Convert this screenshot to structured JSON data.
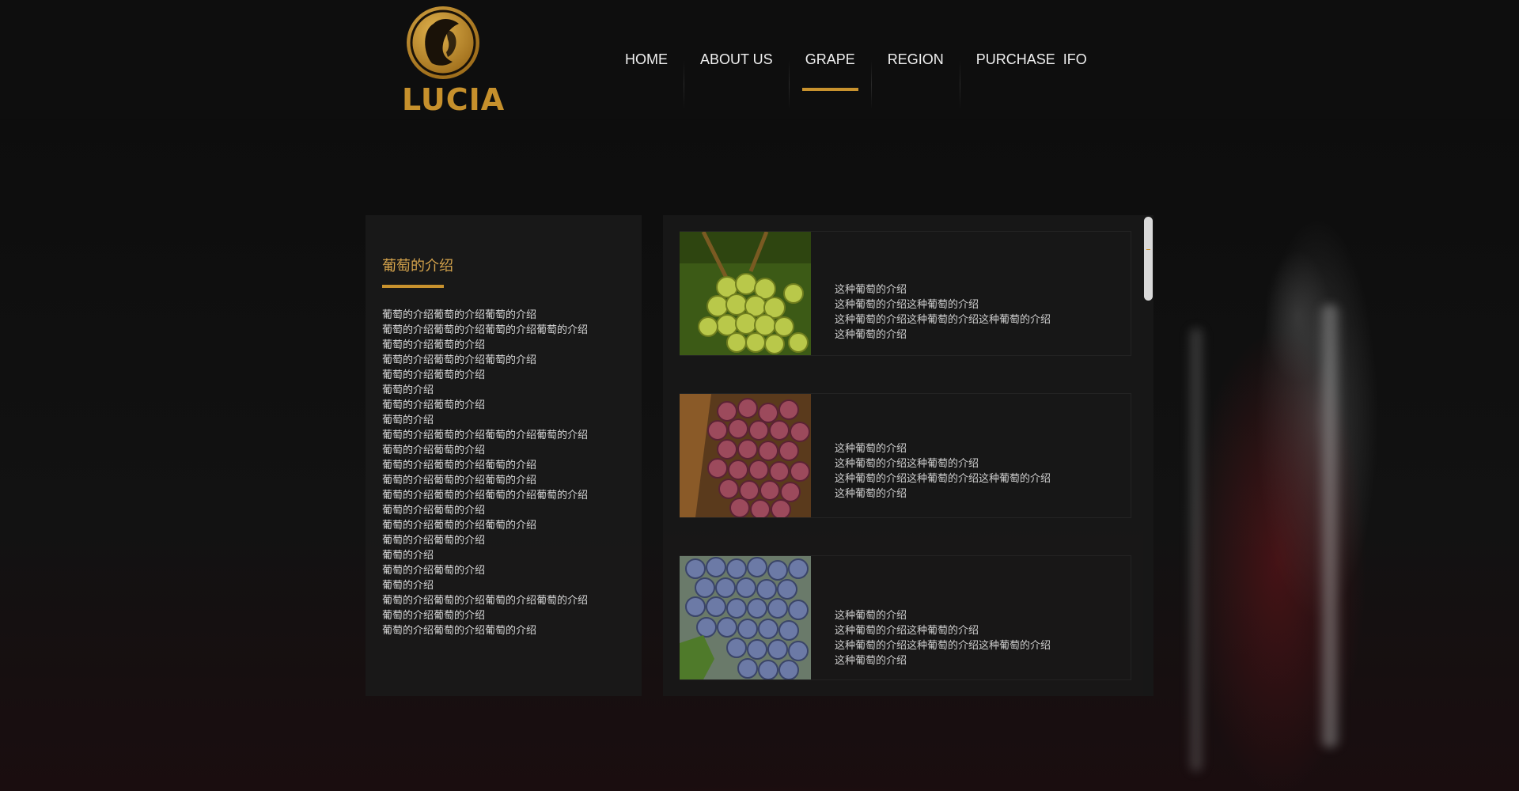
{
  "brand": {
    "logo_text": "LUCIA",
    "accent_color": "#c8922e"
  },
  "nav": {
    "items": [
      {
        "label": "HOME"
      },
      {
        "label": "ABOUT US"
      },
      {
        "label": "GRAPE",
        "active": true
      },
      {
        "label": "REGION"
      },
      {
        "label": "PURCHASE  IFO"
      }
    ]
  },
  "intro": {
    "title": "葡萄的介绍",
    "lines": [
      "葡萄的介绍葡萄的介绍葡萄的介绍",
      "葡萄的介绍葡萄的介绍葡萄的介绍葡萄的介绍",
      "葡萄的介绍葡萄的介绍",
      "葡萄的介绍葡萄的介绍葡萄的介绍",
      "葡萄的介绍葡萄的介绍",
      "葡萄的介绍",
      "葡萄的介绍葡萄的介绍",
      "葡萄的介绍",
      "葡萄的介绍葡萄的介绍葡萄的介绍葡萄的介绍",
      "葡萄的介绍葡萄的介绍",
      "葡萄的介绍葡萄的介绍葡萄的介绍",
      "葡萄的介绍葡萄的介绍葡萄的介绍",
      "葡萄的介绍葡萄的介绍葡萄的介绍葡萄的介绍",
      "葡萄的介绍葡萄的介绍",
      "葡萄的介绍葡萄的介绍葡萄的介绍",
      "葡萄的介绍葡萄的介绍",
      "葡萄的介绍",
      "葡萄的介绍葡萄的介绍",
      "葡萄的介绍",
      "葡萄的介绍葡萄的介绍葡萄的介绍葡萄的介绍",
      "葡萄的介绍葡萄的介绍",
      "葡萄的介绍葡萄的介绍葡萄的介绍"
    ]
  },
  "grapes": [
    {
      "image": "green-grapes",
      "lines": [
        "这种葡萄的介绍",
        "这种葡萄的介绍这种葡萄的介绍",
        "这种葡萄的介绍这种葡萄的介绍这种葡萄的介绍",
        "这种葡萄的介绍"
      ]
    },
    {
      "image": "red-grapes",
      "lines": [
        "这种葡萄的介绍",
        "这种葡萄的介绍这种葡萄的介绍",
        "这种葡萄的介绍这种葡萄的介绍这种葡萄的介绍",
        "这种葡萄的介绍"
      ]
    },
    {
      "image": "blue-grapes",
      "lines": [
        "这种葡萄的介绍",
        "这种葡萄的介绍这种葡萄的介绍",
        "这种葡萄的介绍这种葡萄的介绍这种葡萄的介绍",
        "这种葡萄的介绍"
      ]
    }
  ]
}
